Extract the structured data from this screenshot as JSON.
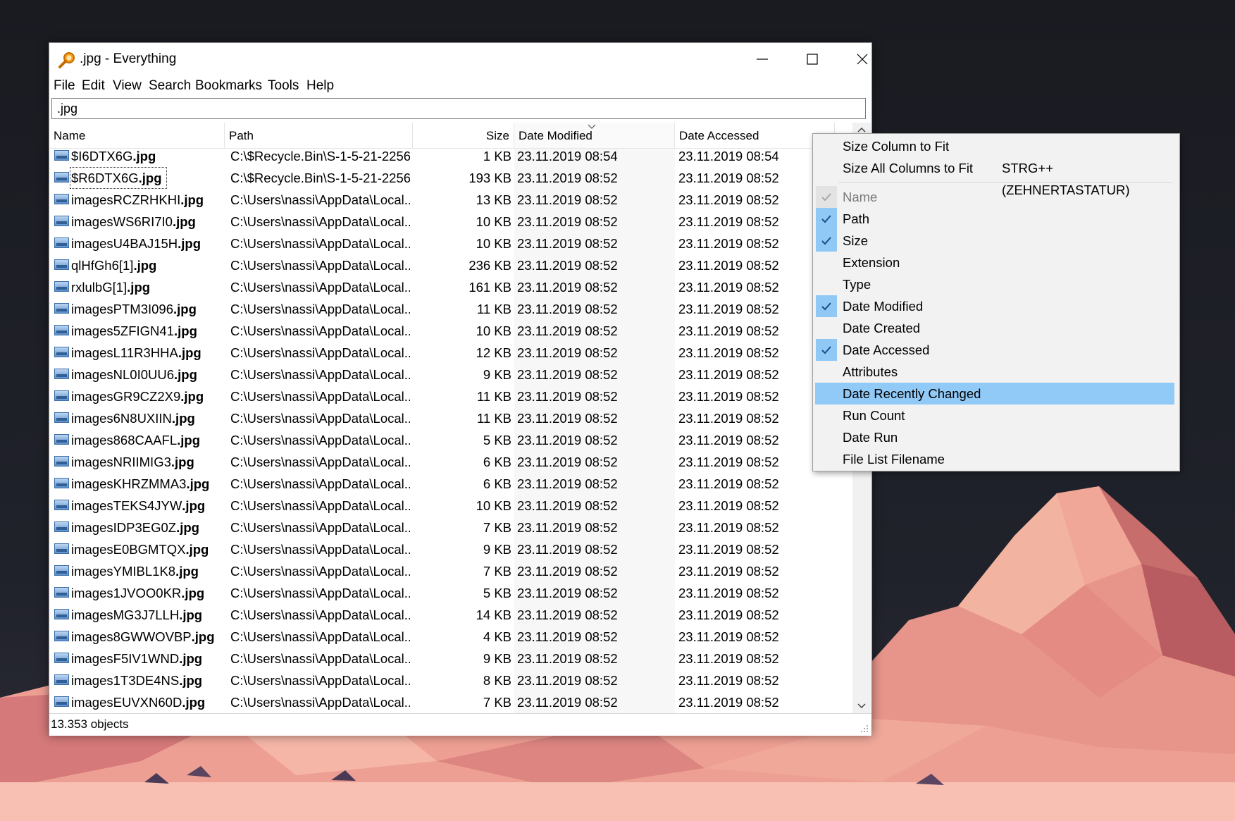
{
  "window": {
    "title": ".jpg - Everything",
    "controls": {
      "minimize": "minimize",
      "maximize": "maximize",
      "close": "close"
    }
  },
  "menu": [
    "File",
    "Edit",
    "View",
    "Search",
    "Bookmarks",
    "Tools",
    "Help"
  ],
  "search": {
    "value": ".jpg"
  },
  "columns": {
    "name": "Name",
    "path": "Path",
    "size": "Size",
    "date_modified": "Date Modified",
    "date_accessed": "Date Accessed",
    "sorted_by": "Date Modified"
  },
  "rows": [
    {
      "base": "$I6DTX6G",
      "ext": ".jpg",
      "path": "C:\\$Recycle.Bin\\S-1-5-21-2256...",
      "size": "1 KB",
      "modified": "23.11.2019 08:54",
      "accessed": "23.11.2019 08:54"
    },
    {
      "base": "$R6DTX6G",
      "ext": ".jpg",
      "path": "C:\\$Recycle.Bin\\S-1-5-21-2256...",
      "size": "193 KB",
      "modified": "23.11.2019 08:52",
      "accessed": "23.11.2019 08:52"
    },
    {
      "base": "imagesRCZRHKHI",
      "ext": ".jpg",
      "path": "C:\\Users\\nassi\\AppData\\Local...",
      "size": "13 KB",
      "modified": "23.11.2019 08:52",
      "accessed": "23.11.2019 08:52"
    },
    {
      "base": "imagesWS6RI7I0",
      "ext": ".jpg",
      "path": "C:\\Users\\nassi\\AppData\\Local...",
      "size": "10 KB",
      "modified": "23.11.2019 08:52",
      "accessed": "23.11.2019 08:52"
    },
    {
      "base": "imagesU4BAJ15H",
      "ext": ".jpg",
      "path": "C:\\Users\\nassi\\AppData\\Local...",
      "size": "10 KB",
      "modified": "23.11.2019 08:52",
      "accessed": "23.11.2019 08:52"
    },
    {
      "base": "qlHfGh6[1]",
      "ext": ".jpg",
      "path": "C:\\Users\\nassi\\AppData\\Local...",
      "size": "236 KB",
      "modified": "23.11.2019 08:52",
      "accessed": "23.11.2019 08:52"
    },
    {
      "base": "rxlulbG[1]",
      "ext": ".jpg",
      "path": "C:\\Users\\nassi\\AppData\\Local...",
      "size": "161 KB",
      "modified": "23.11.2019 08:52",
      "accessed": "23.11.2019 08:52"
    },
    {
      "base": "imagesPTM3I096",
      "ext": ".jpg",
      "path": "C:\\Users\\nassi\\AppData\\Local...",
      "size": "11 KB",
      "modified": "23.11.2019 08:52",
      "accessed": "23.11.2019 08:52"
    },
    {
      "base": "images5ZFIGN41",
      "ext": ".jpg",
      "path": "C:\\Users\\nassi\\AppData\\Local...",
      "size": "10 KB",
      "modified": "23.11.2019 08:52",
      "accessed": "23.11.2019 08:52"
    },
    {
      "base": "imagesL11R3HHA",
      "ext": ".jpg",
      "path": "C:\\Users\\nassi\\AppData\\Local...",
      "size": "12 KB",
      "modified": "23.11.2019 08:52",
      "accessed": "23.11.2019 08:52"
    },
    {
      "base": "imagesNL0I0UU6",
      "ext": ".jpg",
      "path": "C:\\Users\\nassi\\AppData\\Local...",
      "size": "9 KB",
      "modified": "23.11.2019 08:52",
      "accessed": "23.11.2019 08:52"
    },
    {
      "base": "imagesGR9CZ2X9",
      "ext": ".jpg",
      "path": "C:\\Users\\nassi\\AppData\\Local...",
      "size": "11 KB",
      "modified": "23.11.2019 08:52",
      "accessed": "23.11.2019 08:52"
    },
    {
      "base": "images6N8UXIIN",
      "ext": ".jpg",
      "path": "C:\\Users\\nassi\\AppData\\Local...",
      "size": "11 KB",
      "modified": "23.11.2019 08:52",
      "accessed": "23.11.2019 08:52"
    },
    {
      "base": "images868CAAFL",
      "ext": ".jpg",
      "path": "C:\\Users\\nassi\\AppData\\Local...",
      "size": "5 KB",
      "modified": "23.11.2019 08:52",
      "accessed": "23.11.2019 08:52"
    },
    {
      "base": "imagesNRIIMIG3",
      "ext": ".jpg",
      "path": "C:\\Users\\nassi\\AppData\\Local...",
      "size": "6 KB",
      "modified": "23.11.2019 08:52",
      "accessed": "23.11.2019 08:52"
    },
    {
      "base": "imagesKHRZMMA3",
      "ext": ".jpg",
      "path": "C:\\Users\\nassi\\AppData\\Local...",
      "size": "6 KB",
      "modified": "23.11.2019 08:52",
      "accessed": "23.11.2019 08:52"
    },
    {
      "base": "imagesTEKS4JYW",
      "ext": ".jpg",
      "path": "C:\\Users\\nassi\\AppData\\Local...",
      "size": "10 KB",
      "modified": "23.11.2019 08:52",
      "accessed": "23.11.2019 08:52"
    },
    {
      "base": "imagesIDP3EG0Z",
      "ext": ".jpg",
      "path": "C:\\Users\\nassi\\AppData\\Local...",
      "size": "7 KB",
      "modified": "23.11.2019 08:52",
      "accessed": "23.11.2019 08:52"
    },
    {
      "base": "imagesE0BGMTQX",
      "ext": ".jpg",
      "path": "C:\\Users\\nassi\\AppData\\Local...",
      "size": "9 KB",
      "modified": "23.11.2019 08:52",
      "accessed": "23.11.2019 08:52"
    },
    {
      "base": "imagesYMIBL1K8",
      "ext": ".jpg",
      "path": "C:\\Users\\nassi\\AppData\\Local...",
      "size": "7 KB",
      "modified": "23.11.2019 08:52",
      "accessed": "23.11.2019 08:52"
    },
    {
      "base": "images1JVOO0KR",
      "ext": ".jpg",
      "path": "C:\\Users\\nassi\\AppData\\Local...",
      "size": "5 KB",
      "modified": "23.11.2019 08:52",
      "accessed": "23.11.2019 08:52"
    },
    {
      "base": "imagesMG3J7LLH",
      "ext": ".jpg",
      "path": "C:\\Users\\nassi\\AppData\\Local...",
      "size": "14 KB",
      "modified": "23.11.2019 08:52",
      "accessed": "23.11.2019 08:52"
    },
    {
      "base": "images8GWWOVBP",
      "ext": ".jpg",
      "path": "C:\\Users\\nassi\\AppData\\Local...",
      "size": "4 KB",
      "modified": "23.11.2019 08:52",
      "accessed": "23.11.2019 08:52"
    },
    {
      "base": "imagesF5IV1WND",
      "ext": ".jpg",
      "path": "C:\\Users\\nassi\\AppData\\Local...",
      "size": "9 KB",
      "modified": "23.11.2019 08:52",
      "accessed": "23.11.2019 08:52"
    },
    {
      "base": "images1T3DE4NS",
      "ext": ".jpg",
      "path": "C:\\Users\\nassi\\AppData\\Local...",
      "size": "8 KB",
      "modified": "23.11.2019 08:52",
      "accessed": "23.11.2019 08:52"
    },
    {
      "base": "imagesEUVXN60D",
      "ext": ".jpg",
      "path": "C:\\Users\\nassi\\AppData\\Local...",
      "size": "7 KB",
      "modified": "23.11.2019 08:52",
      "accessed": "23.11.2019 08:52"
    }
  ],
  "status": {
    "text": "13.353 objects"
  },
  "context_menu": {
    "items": [
      {
        "label": "Size Column to Fit",
        "checked": false,
        "disabled": false,
        "highlighted": false,
        "shortcut": ""
      },
      {
        "label": "Size All Columns to Fit",
        "checked": false,
        "disabled": false,
        "highlighted": false,
        "shortcut": "STRG++ (ZEHNERTASTATUR)"
      },
      {
        "separator": true
      },
      {
        "label": "Name",
        "checked": true,
        "disabled": true,
        "highlighted": false,
        "shortcut": ""
      },
      {
        "label": "Path",
        "checked": true,
        "disabled": false,
        "highlighted": false,
        "shortcut": ""
      },
      {
        "label": "Size",
        "checked": true,
        "disabled": false,
        "highlighted": false,
        "shortcut": ""
      },
      {
        "label": "Extension",
        "checked": false,
        "disabled": false,
        "highlighted": false,
        "shortcut": ""
      },
      {
        "label": "Type",
        "checked": false,
        "disabled": false,
        "highlighted": false,
        "shortcut": ""
      },
      {
        "label": "Date Modified",
        "checked": true,
        "disabled": false,
        "highlighted": false,
        "shortcut": ""
      },
      {
        "label": "Date Created",
        "checked": false,
        "disabled": false,
        "highlighted": false,
        "shortcut": ""
      },
      {
        "label": "Date Accessed",
        "checked": true,
        "disabled": false,
        "highlighted": false,
        "shortcut": ""
      },
      {
        "label": "Attributes",
        "checked": false,
        "disabled": false,
        "highlighted": false,
        "shortcut": ""
      },
      {
        "label": "Date Recently Changed",
        "checked": false,
        "disabled": false,
        "highlighted": true,
        "shortcut": ""
      },
      {
        "label": "Run Count",
        "checked": false,
        "disabled": false,
        "highlighted": false,
        "shortcut": ""
      },
      {
        "label": "Date Run",
        "checked": false,
        "disabled": false,
        "highlighted": false,
        "shortcut": ""
      },
      {
        "label": "File List Filename",
        "checked": false,
        "disabled": false,
        "highlighted": false,
        "shortcut": ""
      }
    ]
  },
  "colors": {
    "menu_highlight": "#91c9f7",
    "check_box_bg": "#90c8f6",
    "check_box_disabled_bg": "#e3e3e3",
    "sorted_column_bg": "#f7f7f7",
    "disabled_text": "#7a7a7a"
  }
}
